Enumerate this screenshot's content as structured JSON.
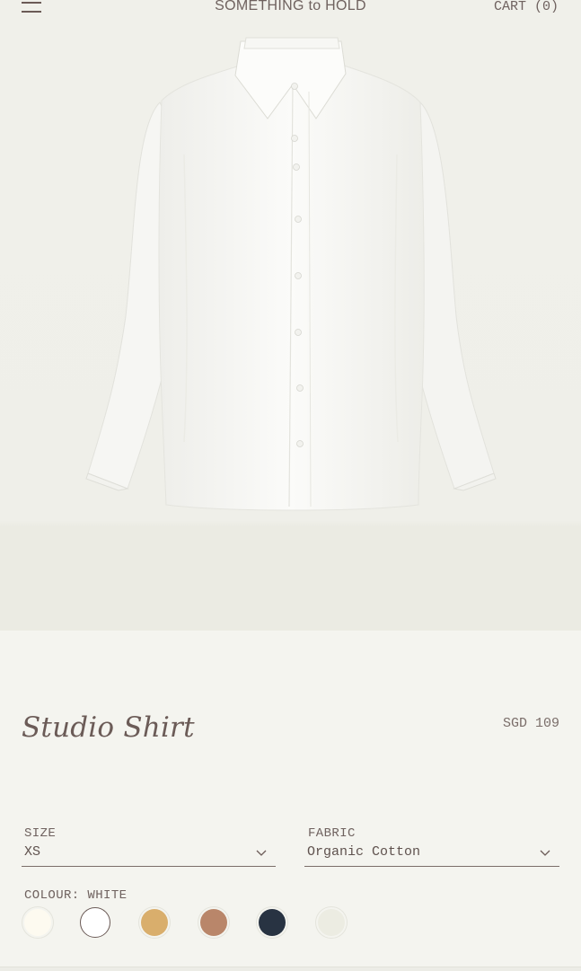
{
  "header": {
    "brand": "SOMETHING to HOLD",
    "cart_label": "CART (0)"
  },
  "product": {
    "title": "Studio Shirt",
    "price": "SGD 109",
    "image_alt": "white button-up shirt"
  },
  "options": {
    "size": {
      "label": "SIZE",
      "value": "XS"
    },
    "fabric": {
      "label": "FABRIC",
      "value": "Organic Cotton"
    },
    "colour": {
      "label": "COLOUR: WHITE",
      "swatches": [
        {
          "name": "ivory",
          "color": "#fdfaf0",
          "selected": false
        },
        {
          "name": "white",
          "color": "#ffffff",
          "selected": true
        },
        {
          "name": "sand",
          "color": "#d9ae6c",
          "selected": false
        },
        {
          "name": "tan",
          "color": "#b9866a",
          "selected": false
        },
        {
          "name": "navy",
          "color": "#283342",
          "selected": false
        },
        {
          "name": "off-white",
          "color": "#ecece2",
          "selected": false
        }
      ]
    }
  },
  "colors": {
    "background": "#f4f4ef",
    "hero_background": "#f0f0ea",
    "text": "#6b5b57"
  }
}
